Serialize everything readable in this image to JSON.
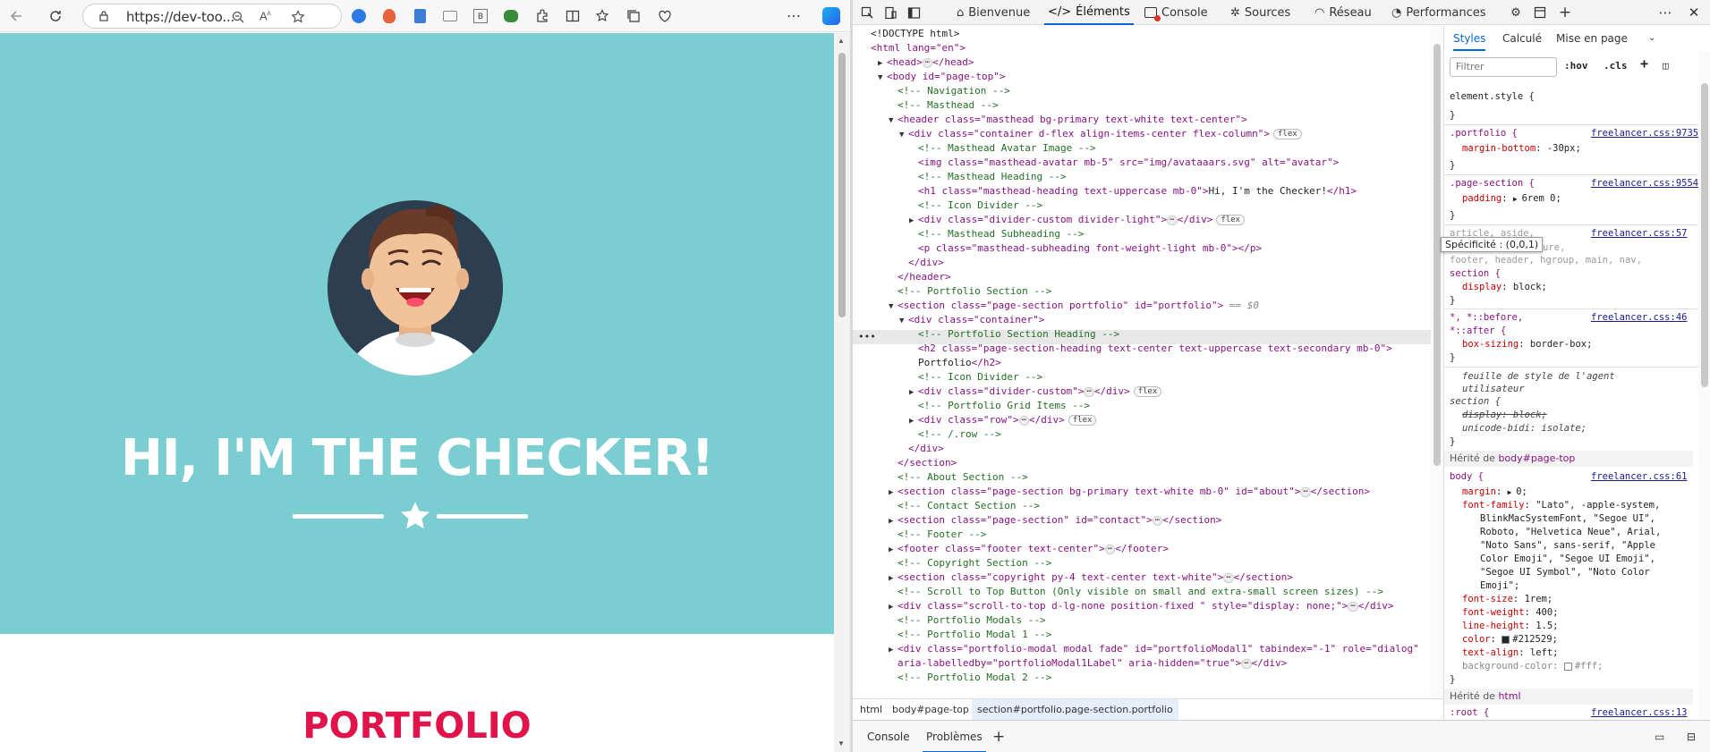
{
  "browser": {
    "url": "https://dev-too...",
    "icons": [
      "back-icon",
      "refresh-icon",
      "lock-icon",
      "zoom-icon",
      "read-aloud-icon",
      "favorite-icon",
      "extension-icons",
      "split-screen-icon",
      "favorites-icon",
      "collections-icon",
      "performance-icon",
      "more-icon",
      "copilot-icon"
    ]
  },
  "page": {
    "title": "HI, I'M THE CHECKER!",
    "portfolio": "PORTFOLIO",
    "colors": {
      "primary": "#7acdd0",
      "secondary": "#e0134a",
      "avatar_bg": "#2c3e50"
    }
  },
  "devtools": {
    "tabs": [
      "Bienvenue",
      "Éléments",
      "Console",
      "Sources",
      "Réseau",
      "Performances"
    ],
    "active_tab": "Éléments",
    "styles_tabs": [
      "Styles",
      "Calculé",
      "Mise en page"
    ],
    "filter_placeholder": "Filtrer",
    "hov": ":hov",
    "cls": ".cls",
    "breadcrumb": [
      "html",
      "body#page-top",
      "section#portfolio.page-section.portfolio"
    ],
    "drawer_tabs": [
      "Console",
      "Problèmes"
    ],
    "tooltip": "Spécificité : (0,0,1)",
    "dom_marker": "== $0",
    "ellipsis": "⋯",
    "badges": {
      "flex": "flex"
    },
    "dom": {
      "doctype": "<!DOCTYPE html>",
      "html_open": "<html lang=\"en\">",
      "head": "<head>",
      "head_close": "</head>",
      "body": "<body id=\"page-top\">",
      "c_nav": "<!-- Navigation -->",
      "c_mast": "<!-- Masthead -->",
      "header": "<header class=\"masthead bg-primary text-white text-center\">",
      "container": "<div class=\"container d-flex align-items-center flex-column\">",
      "c_avatar": "<!-- Masthead Avatar Image -->",
      "img": "<img class=\"masthead-avatar mb-5\" src=\"img/avataaars.svg\" alt=\"avatar\">",
      "c_heading": "<!-- Masthead Heading -->",
      "h1_open": "<h1 class=\"masthead-heading text-uppercase mb-0\">",
      "h1_text": "Hi, I'm the Checker!",
      "h1_close": "</h1>",
      "c_icondiv": "<!-- Icon Divider -->",
      "divider_light": "<div class=\"divider-custom divider-light\">",
      "div_close": "</div>",
      "c_subhead": "<!-- Masthead Subheading -->",
      "p_sub": "<p class=\"masthead-subheading font-weight-light mb-0\"></p>",
      "header_close": "</header>",
      "c_portfolio": "<!-- Portfolio Section -->",
      "section_portfolio": "<section class=\"page-section portfolio\" id=\"portfolio\">",
      "div_container": "<div class=\"container\">",
      "c_port_heading": "<!-- Portfolio Section Heading -->",
      "h2_open": "<h2 class=\"page-section-heading text-center text-uppercase text-secondary mb-0\">",
      "h2_text": "Portfolio",
      "h2_close": "</h2>",
      "divider_custom": "<div class=\"divider-custom\">",
      "c_grid": "<!-- Portfolio Grid Items -->",
      "row": "<div class=\"row\">",
      "c_row_end": "<!-- /.row -->",
      "section_close": "</section>",
      "c_about": "<!-- About Section -->",
      "section_about": "<section class=\"page-section bg-primary text-white mb-0\" id=\"about\">",
      "c_contact": "<!-- Contact Section -->",
      "section_contact": "<section class=\"page-section\" id=\"contact\">",
      "c_footer": "<!-- Footer -->",
      "footer": "<footer class=\"footer text-center\">",
      "footer_close": "</footer>",
      "c_copyright": "<!-- Copyright Section -->",
      "section_copyright": "<section class=\"copyright py-4 text-center text-white\">",
      "c_scroll": "<!-- Scroll to Top Button (Only visible on small and extra-small screen sizes) -->",
      "div_scroll": "<div class=\"scroll-to-top d-lg-none position-fixed \" style=\"display: none;\">",
      "c_modals": "<!-- Portfolio Modals -->",
      "c_modal1": "<!-- Portfolio Modal 1 -->",
      "div_modal1a": "<div class=\"portfolio-modal modal fade\" id=\"portfolioModal1\" tabindex=\"-1\" role=\"dialog\"",
      "div_modal1b": "aria-labelledby=\"portfolioModal1Label\" aria-hidden=\"true\">",
      "c_modal2": "<!-- Portfolio Modal 2 -->"
    },
    "styles": {
      "element_style": "element.style {",
      "close": "}",
      "r1_sel": ".portfolio {",
      "r1_src": "freelancer.css:9735",
      "r1_p": "margin-bottom",
      "r1_v": "-30px;",
      "r2_sel": ".page-section {",
      "r2_src": "freelancer.css:9554",
      "r2_p": "padding",
      "r2_v": "6rem 0;",
      "r3_sel_a": "article, aside,",
      "r3_sel_a2": "ure,",
      "r3_src": "freelancer.css:57",
      "r3_sel_b": "footer, header, hgroup, main, nav,",
      "r3_sel_c": "section {",
      "r3_p": "display",
      "r3_v": "block;",
      "r4_sel_a": "*, *::before,",
      "r4_sel_b": "*::after {",
      "r4_src": "freelancer.css:46",
      "r4_p": "box-sizing",
      "r4_v": "border-box;",
      "ua_label_a": "feuille de style de l'agent",
      "ua_label_b": "utilisateur",
      "ua_sel": "section {",
      "ua_p1": "display: block;",
      "ua_p2": "unicode-bidi: isolate;",
      "inh1_label": "Hérité de ",
      "inh1_target": "body#page-top",
      "body_sel": "body {",
      "body_src": "freelancer.css:61",
      "b_margin": "margin",
      "b_margin_v": "0;",
      "b_ff": "font-family",
      "b_ff_v1": "\"Lato\", -apple-system,",
      "b_ff_v2": "BlinkMacSystemFont, \"Segoe UI\",",
      "b_ff_v3": "Roboto, \"Helvetica Neue\", Arial,",
      "b_ff_v4": "\"Noto Sans\", sans-serif, \"Apple",
      "b_ff_v5": "Color Emoji\", \"Segoe UI Emoji\",",
      "b_ff_v6": "\"Segoe UI Symbol\", \"Noto Color",
      "b_ff_v7": "Emoji\";",
      "b_fs": "font-size",
      "b_fs_v": "1rem;",
      "b_fw": "font-weight",
      "b_fw_v": "400;",
      "b_lh": "line-height",
      "b_lh_v": "1.5;",
      "b_c": "color",
      "b_c_v": "#212529;",
      "b_ta": "text-align",
      "b_ta_v": "left;",
      "b_bg": "background-color",
      "b_bg_v": "#fff;",
      "inh2_label": "Hérité de ",
      "inh2_target": "html",
      "root_sel": ":root {",
      "root_src": "freelancer.css:13"
    }
  }
}
